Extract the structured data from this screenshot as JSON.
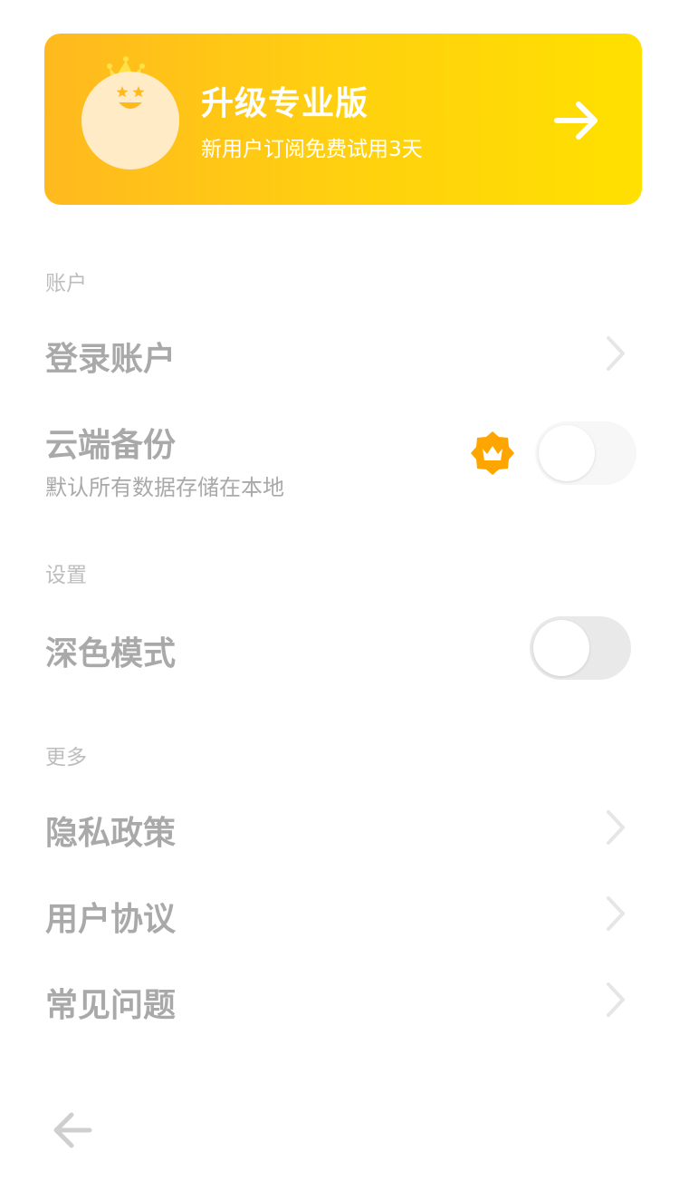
{
  "upgrade_banner": {
    "title": "升级专业版",
    "subtitle": "新用户订阅免费试用3天",
    "icon": "arrow-right-icon",
    "gradient_start": "#ffb91f",
    "gradient_end": "#ffe000"
  },
  "sections": {
    "account": {
      "label": "账户",
      "login": {
        "title": "登录账户",
        "icon": "chevron-right-icon"
      },
      "cloud_backup": {
        "title": "云端备份",
        "subtitle": "默认所有数据存储在本地",
        "premium_badge_icon": "crown-badge-icon",
        "toggle_on": false
      }
    },
    "settings": {
      "label": "设置",
      "dark_mode": {
        "title": "深色模式",
        "toggle_on": false
      }
    },
    "more": {
      "label": "更多",
      "privacy": {
        "title": "隐私政策",
        "icon": "chevron-right-icon"
      },
      "user_agreement": {
        "title": "用户协议",
        "icon": "chevron-right-icon"
      },
      "faq": {
        "title": "常见问题",
        "icon": "chevron-right-icon"
      }
    }
  },
  "footer": {
    "back_icon": "arrow-left-icon"
  },
  "colors": {
    "accent": "#ffc107",
    "badge": "#ffa500",
    "text_primary": "#a9a9a9",
    "text_section": "#bdbdbd"
  }
}
